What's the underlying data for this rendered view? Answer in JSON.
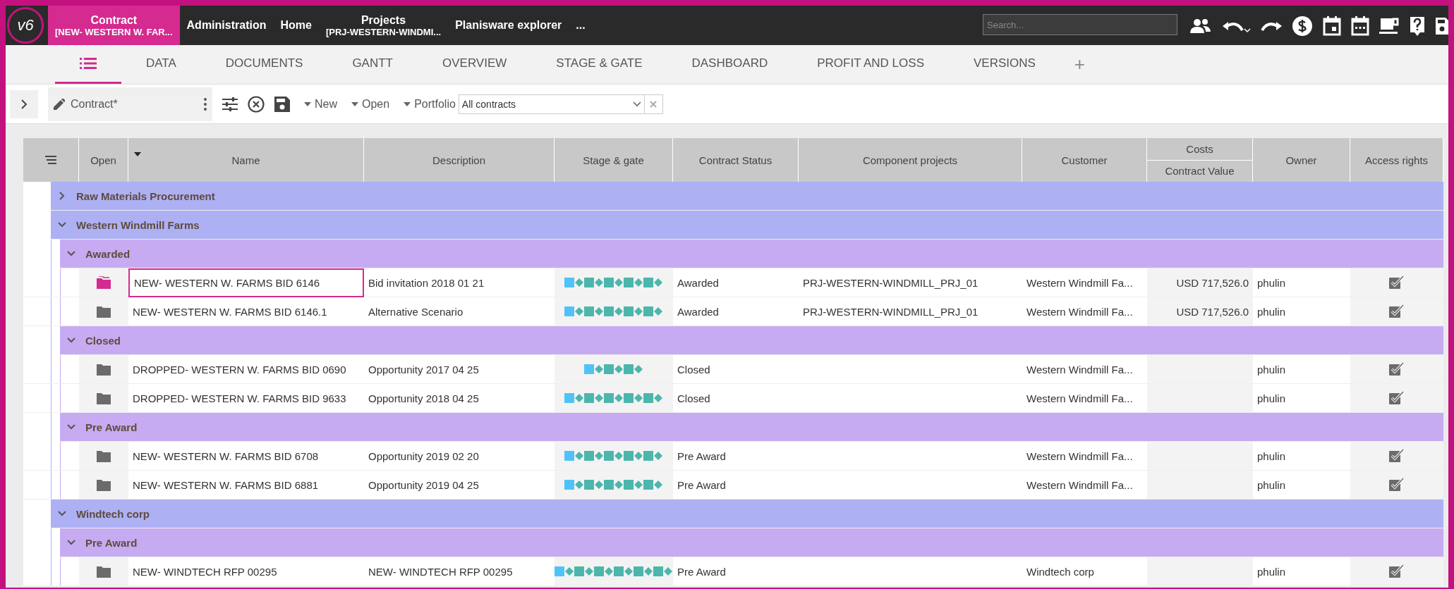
{
  "logo": "v6",
  "nav": {
    "items": [
      {
        "title": "Contract",
        "subtitle": "[NEW- WESTERN W. FAR...",
        "selected": true
      },
      {
        "title": "Administration",
        "selected": false
      },
      {
        "title": "Home",
        "selected": false
      },
      {
        "title": "Projects",
        "subtitle": "[PRJ-WESTERN-WINDMI...",
        "selected": false
      },
      {
        "title": "Planisware explorer",
        "selected": false
      },
      {
        "title": "...",
        "selected": false
      }
    ],
    "search": {
      "placeholder": "Search..."
    }
  },
  "tabs": [
    {
      "kind": "icon",
      "selected": true
    },
    {
      "kind": "text",
      "label": "DATA",
      "selected": false
    },
    {
      "kind": "text",
      "label": "DOCUMENTS",
      "selected": false
    },
    {
      "kind": "text",
      "label": "GANTT",
      "selected": false
    },
    {
      "kind": "text",
      "label": "OVERVIEW",
      "selected": false
    },
    {
      "kind": "text",
      "label": "STAGE & GATE",
      "selected": false
    },
    {
      "kind": "text",
      "label": "DASHBOARD",
      "selected": false
    },
    {
      "kind": "text",
      "label": "PROFIT AND LOSS",
      "selected": false
    },
    {
      "kind": "text",
      "label": "VERSIONS",
      "selected": false
    }
  ],
  "add_tab": "+",
  "toolbar": {
    "panel_label": "Contract*",
    "actions": [
      "New",
      "Open",
      "Portfolio"
    ],
    "portfolio_select": {
      "value": "All contracts"
    }
  },
  "table": {
    "columns": [
      {
        "label": "Open"
      },
      {
        "label": "Name",
        "sorted": true
      },
      {
        "label": "Description"
      },
      {
        "label": "Stage & gate"
      },
      {
        "label": "Contract Status"
      },
      {
        "label": "Component projects"
      },
      {
        "label": "Customer"
      },
      {
        "label": "Costs",
        "sublabel": "Contract Value"
      },
      {
        "label": "Owner"
      },
      {
        "label": "Access rights"
      }
    ],
    "groups": [
      {
        "label": "Raw Materials Procurement",
        "expanded": false
      },
      {
        "label": "Western Windmill Farms",
        "expanded": true,
        "children": [
          {
            "label": "Awarded",
            "expanded": true,
            "rows": [
              {
                "name": "NEW- WESTERN W. FARMS BID 6146",
                "description": "Bid invitation 2018 01 21",
                "stages": [
                  {
                    "kind": "square",
                    "color": "#4fc3f7"
                  },
                  {
                    "kind": "diamond",
                    "color": "#4db6ac"
                  },
                  {
                    "kind": "square",
                    "color": "#4db6ac"
                  },
                  {
                    "kind": "diamond",
                    "color": "#4db6ac"
                  },
                  {
                    "kind": "square",
                    "color": "#4db6ac"
                  },
                  {
                    "kind": "diamond",
                    "color": "#4db6ac"
                  },
                  {
                    "kind": "square",
                    "color": "#4db6ac"
                  },
                  {
                    "kind": "diamond",
                    "color": "#4db6ac"
                  },
                  {
                    "kind": "square",
                    "color": "#4db6ac"
                  },
                  {
                    "kind": "diamond",
                    "color": "#4db6ac"
                  }
                ],
                "status": "Awarded",
                "component": "PRJ-WESTERN-WINDMILL_PRJ_01",
                "customer": "Western Windmill Fa...",
                "value": "USD 717,526.0",
                "owner": "phulin",
                "selected": true
              },
              {
                "name": "NEW- WESTERN W. FARMS BID 6146.1",
                "description": "Alternative Scenario",
                "stages": [
                  {
                    "kind": "square",
                    "color": "#4fc3f7"
                  },
                  {
                    "kind": "diamond",
                    "color": "#4db6ac"
                  },
                  {
                    "kind": "square",
                    "color": "#4db6ac"
                  },
                  {
                    "kind": "diamond",
                    "color": "#4db6ac"
                  },
                  {
                    "kind": "square",
                    "color": "#4db6ac"
                  },
                  {
                    "kind": "diamond",
                    "color": "#4db6ac"
                  },
                  {
                    "kind": "square",
                    "color": "#4db6ac"
                  },
                  {
                    "kind": "diamond",
                    "color": "#4db6ac"
                  },
                  {
                    "kind": "square",
                    "color": "#4db6ac"
                  },
                  {
                    "kind": "diamond",
                    "color": "#4db6ac"
                  }
                ],
                "status": "Awarded",
                "component": "PRJ-WESTERN-WINDMILL_PRJ_01",
                "customer": "Western Windmill Fa...",
                "value": "USD 717,526.0",
                "owner": "phulin",
                "selected": false
              }
            ]
          },
          {
            "label": "Closed",
            "expanded": true,
            "rows": [
              {
                "name": "DROPPED- WESTERN W. FARMS BID 0690",
                "description": "Opportunity 2017 04 25",
                "stages": [
                  {
                    "kind": "square",
                    "color": "#4fc3f7"
                  },
                  {
                    "kind": "diamond",
                    "color": "#4db6ac"
                  },
                  {
                    "kind": "square",
                    "color": "#4db6ac"
                  },
                  {
                    "kind": "diamond",
                    "color": "#4db6ac"
                  },
                  {
                    "kind": "square",
                    "color": "#4db6ac"
                  },
                  {
                    "kind": "diamond",
                    "color": "#4db6ac"
                  }
                ],
                "status": "Closed",
                "customer": "Western Windmill Fa...",
                "owner": "phulin",
                "selected": false
              },
              {
                "name": "DROPPED- WESTERN W. FARMS BID 9633",
                "description": "Opportunity 2018 04 25",
                "stages": [
                  {
                    "kind": "square",
                    "color": "#4fc3f7"
                  },
                  {
                    "kind": "diamond",
                    "color": "#4db6ac"
                  },
                  {
                    "kind": "square",
                    "color": "#4db6ac"
                  },
                  {
                    "kind": "diamond",
                    "color": "#4db6ac"
                  },
                  {
                    "kind": "square",
                    "color": "#4db6ac"
                  },
                  {
                    "kind": "diamond",
                    "color": "#4db6ac"
                  },
                  {
                    "kind": "square",
                    "color": "#4db6ac"
                  },
                  {
                    "kind": "diamond",
                    "color": "#4db6ac"
                  },
                  {
                    "kind": "square",
                    "color": "#4db6ac"
                  },
                  {
                    "kind": "diamond",
                    "color": "#4db6ac"
                  }
                ],
                "status": "Closed",
                "customer": "Western Windmill Fa...",
                "owner": "phulin",
                "selected": false
              }
            ]
          },
          {
            "label": "Pre Award",
            "expanded": true,
            "rows": [
              {
                "name": "NEW- WESTERN W. FARMS BID 6708",
                "description": "Opportunity 2019 02 20",
                "stages": [
                  {
                    "kind": "square",
                    "color": "#4fc3f7"
                  },
                  {
                    "kind": "diamond",
                    "color": "#4db6ac"
                  },
                  {
                    "kind": "square",
                    "color": "#4db6ac"
                  },
                  {
                    "kind": "diamond",
                    "color": "#4db6ac"
                  },
                  {
                    "kind": "square",
                    "color": "#4db6ac"
                  },
                  {
                    "kind": "diamond",
                    "color": "#4db6ac"
                  },
                  {
                    "kind": "square",
                    "color": "#4db6ac"
                  },
                  {
                    "kind": "diamond",
                    "color": "#4db6ac"
                  },
                  {
                    "kind": "square",
                    "color": "#4db6ac"
                  },
                  {
                    "kind": "diamond",
                    "color": "#4db6ac"
                  }
                ],
                "status": "Pre Award",
                "customer": "Western Windmill Fa...",
                "owner": "phulin",
                "selected": false
              },
              {
                "name": "NEW- WESTERN W. FARMS BID 6881",
                "description": "Opportunity 2019 04 25",
                "stages": [
                  {
                    "kind": "square",
                    "color": "#4fc3f7"
                  },
                  {
                    "kind": "diamond",
                    "color": "#4db6ac"
                  },
                  {
                    "kind": "square",
                    "color": "#4db6ac"
                  },
                  {
                    "kind": "diamond",
                    "color": "#4db6ac"
                  },
                  {
                    "kind": "square",
                    "color": "#4db6ac"
                  },
                  {
                    "kind": "diamond",
                    "color": "#4db6ac"
                  },
                  {
                    "kind": "square",
                    "color": "#4db6ac"
                  },
                  {
                    "kind": "diamond",
                    "color": "#4db6ac"
                  },
                  {
                    "kind": "square",
                    "color": "#4db6ac"
                  },
                  {
                    "kind": "diamond",
                    "color": "#4db6ac"
                  }
                ],
                "status": "Pre Award",
                "customer": "Western Windmill Fa...",
                "owner": "phulin",
                "selected": false
              }
            ]
          }
        ]
      },
      {
        "label": "Windtech corp",
        "expanded": true,
        "children": [
          {
            "label": "Pre Award",
            "expanded": true,
            "rows": [
              {
                "name": "NEW- WINDTECH RFP 00295",
                "description": "NEW- WINDTECH RFP 00295",
                "stages": [
                  {
                    "kind": "square",
                    "color": "#4fc3f7"
                  },
                  {
                    "kind": "diamond",
                    "color": "#4db6ac"
                  },
                  {
                    "kind": "square",
                    "color": "#4db6ac"
                  },
                  {
                    "kind": "diamond",
                    "color": "#4db6ac"
                  },
                  {
                    "kind": "square",
                    "color": "#4db6ac"
                  },
                  {
                    "kind": "diamond",
                    "color": "#4db6ac"
                  },
                  {
                    "kind": "square",
                    "color": "#4db6ac"
                  },
                  {
                    "kind": "diamond",
                    "color": "#4db6ac"
                  },
                  {
                    "kind": "square",
                    "color": "#4db6ac"
                  },
                  {
                    "kind": "diamond",
                    "color": "#4db6ac"
                  },
                  {
                    "kind": "square",
                    "color": "#4db6ac"
                  },
                  {
                    "kind": "diamond",
                    "color": "#4db6ac"
                  }
                ],
                "status": "Pre Award",
                "customer": "Windtech corp",
                "owner": "phulin",
                "selected": false
              }
            ]
          }
        ]
      }
    ]
  }
}
